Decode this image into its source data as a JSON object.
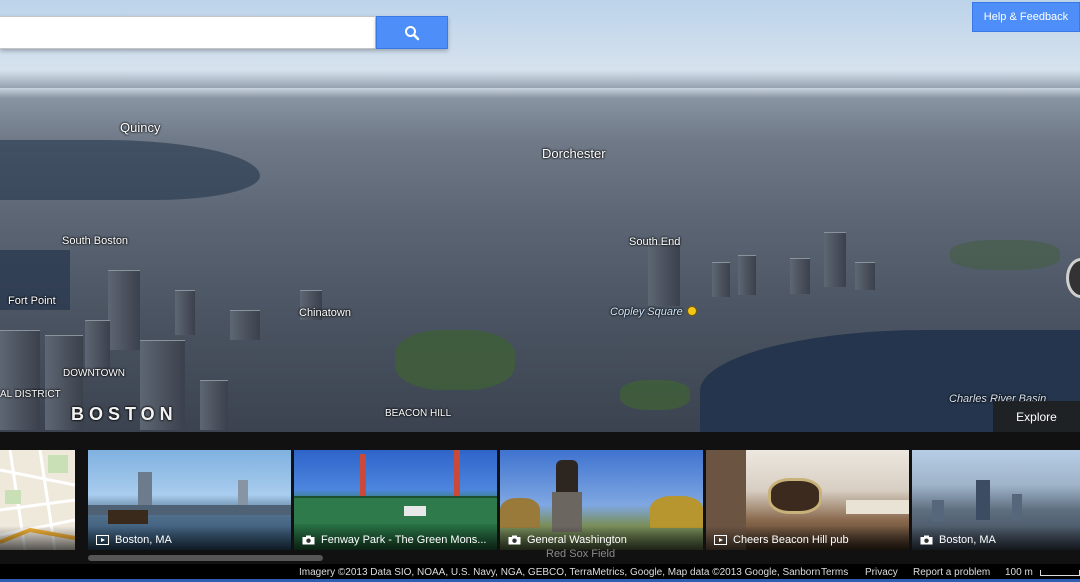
{
  "search": {
    "value": "",
    "placeholder": ""
  },
  "header": {
    "help_label": "Help & Feedback"
  },
  "map": {
    "labels": {
      "quincy": "Quincy",
      "dorchester": "Dorchester",
      "south_boston": "South Boston",
      "south_end": "South End",
      "fort_point": "Fort Point",
      "chinatown": "Chinatown",
      "copley_square": "Copley Square",
      "downtown": "DOWNTOWN",
      "financial_district": "AL DISTRICT",
      "boston": "BOSTON",
      "beacon_hill": "BEACON HILL",
      "charles_river_basin": "Charles River Basin"
    },
    "explore_label": "Explore"
  },
  "filmstrip": {
    "items": [
      {
        "label": "",
        "kind": "map"
      },
      {
        "label": "Boston, MA",
        "kind": "video"
      },
      {
        "label": "Fenway Park - The Green Mons...",
        "kind": "photo"
      },
      {
        "label": "General Washington",
        "kind": "photo"
      },
      {
        "label": "Cheers Beacon Hill pub",
        "kind": "video"
      },
      {
        "label": "Boston, MA",
        "kind": "photo"
      }
    ],
    "overlay_text": "Red Sox Field"
  },
  "footer": {
    "attribution": "Imagery ©2013 Data SIO, NOAA, U.S. Navy, NGA, GEBCO, TerraMetrics, Google, Map data ©2013 Google, Sanborn",
    "terms": "Terms",
    "privacy": "Privacy",
    "report": "Report a problem",
    "scale": "100 m"
  },
  "colors": {
    "accent_blue": "#4d8ef8",
    "poi_yellow": "#f5c518"
  },
  "icons": {
    "search": "search-icon",
    "video": "video-icon",
    "photo": "camera-icon"
  }
}
